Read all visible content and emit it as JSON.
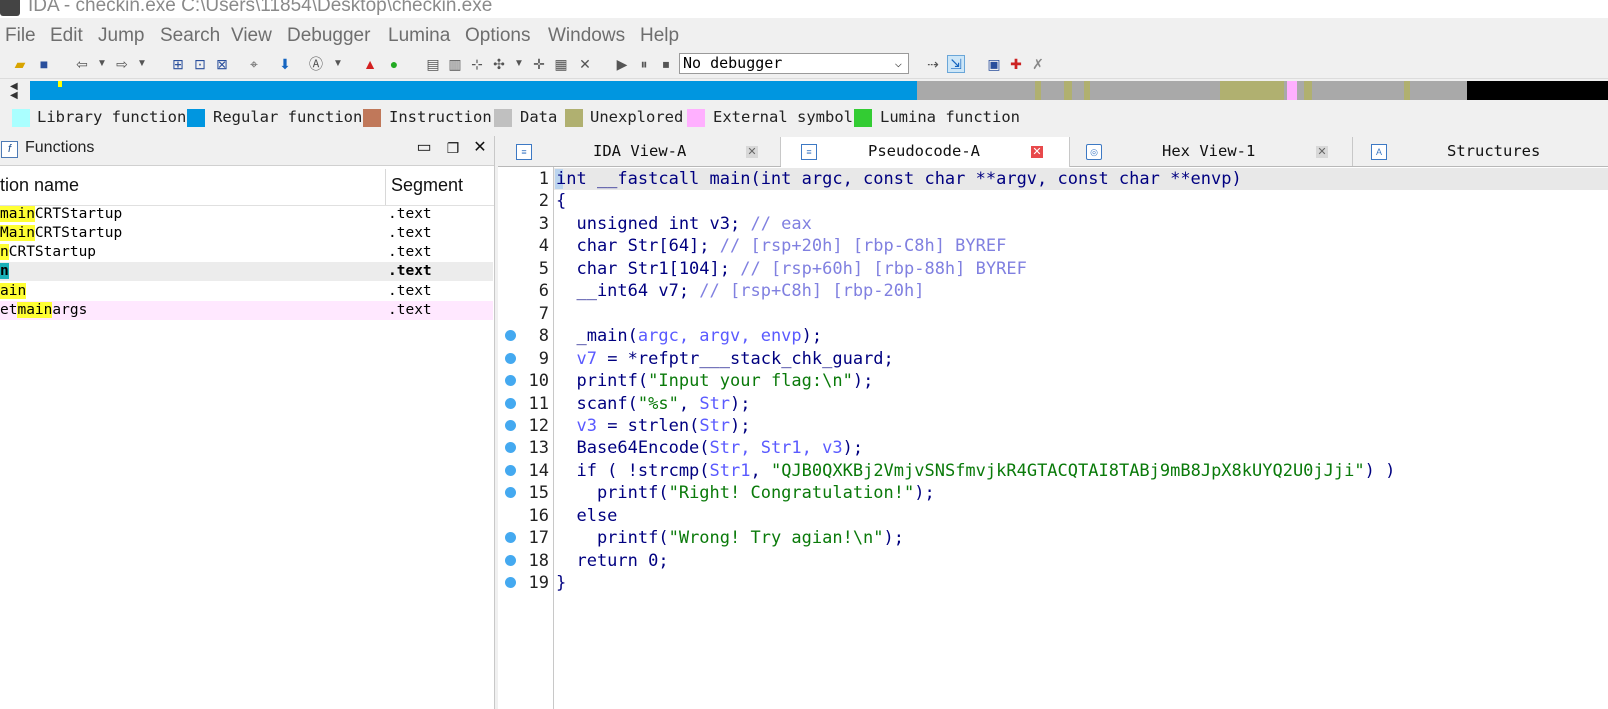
{
  "window": {
    "title": "IDA - checkin.exe C:\\Users\\11854\\Desktop\\checkin.exe"
  },
  "menu": [
    "File",
    "Edit",
    "Jump",
    "Search",
    "View",
    "Debugger",
    "Lumina",
    "Options",
    "Windows",
    "Help"
  ],
  "toolbar": {
    "debugger_value": "No debugger"
  },
  "legend": [
    {
      "label": "Library function",
      "color": "#aaffff"
    },
    {
      "label": "Regular function",
      "color": "#0096e0"
    },
    {
      "label": "Instruction",
      "color": "#c0785a"
    },
    {
      "label": "Data",
      "color": "#c0c0c0"
    },
    {
      "label": "Unexplored",
      "color": "#b0b070"
    },
    {
      "label": "External symbol",
      "color": "#ffb0ff"
    },
    {
      "label": "Lumina function",
      "color": "#33cc33"
    }
  ],
  "functions_pane": {
    "title": "Functions",
    "col_name": "tion name",
    "col_segment": "Segment",
    "rows": [
      {
        "pre": "",
        "hl": "main",
        "post": "CRTStartup",
        "segment": ".text"
      },
      {
        "pre": "",
        "hl": "Main",
        "post": "CRTStartup",
        "segment": ".text"
      },
      {
        "pre": "",
        "hl": "n",
        "post": "CRTStartup",
        "segment": ".text"
      },
      {
        "pre": "",
        "hl": "n",
        "post": "",
        "segment": ".text"
      },
      {
        "pre": "",
        "hl": "ain",
        "post": "",
        "segment": ".text"
      },
      {
        "pre": "et",
        "hl": "main",
        "post": "args",
        "segment": ".text"
      }
    ]
  },
  "tabs": [
    {
      "label": "IDA View-A",
      "icon": "ida-view-icon"
    },
    {
      "label": "Pseudocode-A",
      "icon": "pseudocode-icon"
    },
    {
      "label": "Hex View-1",
      "icon": "hex-view-icon"
    },
    {
      "label": "Structures",
      "icon": "structures-icon"
    }
  ],
  "code": {
    "line_numbers": [
      "1",
      "2",
      "3",
      "4",
      "5",
      "6",
      "7",
      "8",
      "9",
      "10",
      "11",
      "12",
      "13",
      "14",
      "15",
      "16",
      "17",
      "18",
      "19"
    ],
    "l1": "int __fastcall main(int argc, const char **argv, const char **envp)",
    "l2": "{",
    "l3a": "  unsigned int v3; ",
    "l3b": "// eax",
    "l4a": "  char Str[64]; ",
    "l4b": "// [rsp+20h] [rbp-C8h] BYREF",
    "l5a": "  char Str1[104]; ",
    "l5b": "// [rsp+60h] [rbp-88h] BYREF",
    "l6a": "  __int64 v7; ",
    "l6b": "// [rsp+C8h] [rbp-20h]",
    "l8a": "  _main(",
    "l8b": "argc, argv, envp",
    "l8c": ");",
    "l9a": "  ",
    "l9b": "v7",
    "l9c": " = *refptr___stack_chk_guard;",
    "l10a": "  printf(",
    "l10b": "\"Input your flag:\\n\"",
    "l10c": ");",
    "l11a": "  scanf(",
    "l11b": "\"%s\"",
    "l11c": ", ",
    "l11d": "Str",
    "l11e": ");",
    "l12a": "  ",
    "l12b": "v3",
    "l12c": " = strlen(",
    "l12d": "Str",
    "l12e": ");",
    "l13a": "  Base64Encode(",
    "l13b": "Str, Str1, v3",
    "l13c": ");",
    "l14a": "  if ( !strcmp(",
    "l14b": "Str1",
    "l14c": ", ",
    "l14d": "\"QJB0QXKBj2VmjvSNSfmvjkR4GTACQTAI8TABj9mB8JpX8kUYQ2U0jJji\"",
    "l14e": ") )",
    "l15a": "    printf(",
    "l15b": "\"Right! Congratulation!\"",
    "l15c": ");",
    "l16": "  else",
    "l17a": "    printf(",
    "l17b": "\"Wrong! Try agian!\\n\"",
    "l17c": ");",
    "l18": "  return 0;",
    "l19": "}"
  }
}
